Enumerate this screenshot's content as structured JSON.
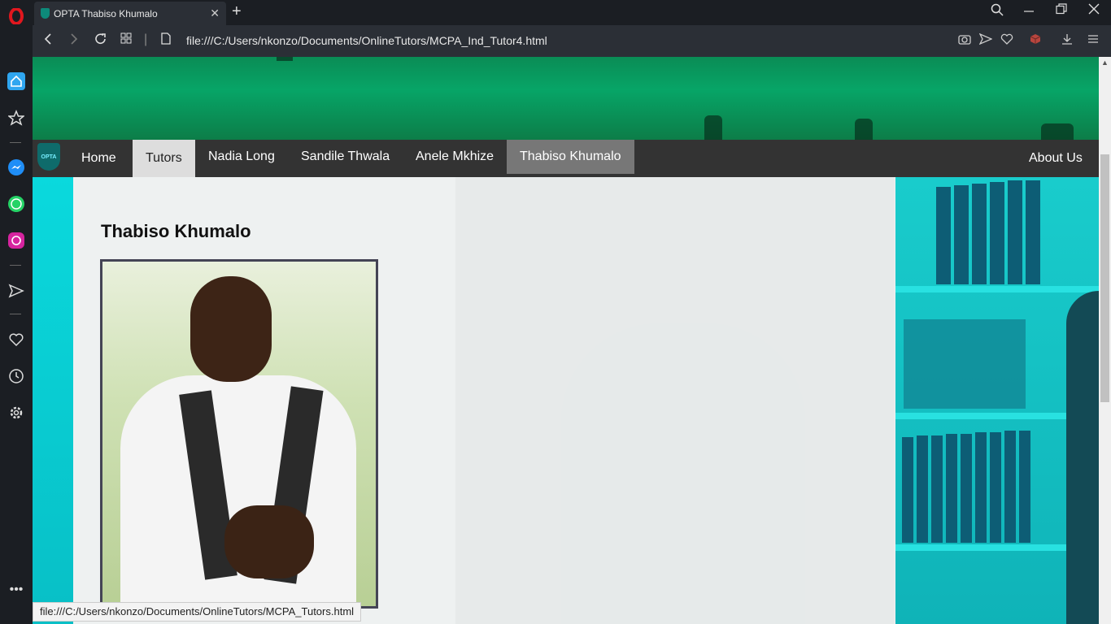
{
  "browser": {
    "tab_title": "OPTA Thabiso Khumalo",
    "url": "file:///C:/Users/nkonzo/Documents/OnlineTutors/MCPA_Ind_Tutor4.html",
    "status_url": "file:///C:/Users/nkonzo/Documents/OnlineTutors/MCPA_Tutors.html"
  },
  "site": {
    "logo_text": "OPTA",
    "nav": {
      "home": "Home",
      "tutors": "Tutors",
      "tutor1": "Nadia Long",
      "tutor2": "Sandile Thwala",
      "tutor3": "Anele Mkhize",
      "tutor4": "Thabiso Khumalo",
      "about": "About Us"
    },
    "tutor_heading": "Thabiso Khumalo"
  },
  "colors": {
    "banner_green": "#07a567",
    "teal_accent": "#0ad9dd",
    "navbar": "#333333"
  }
}
